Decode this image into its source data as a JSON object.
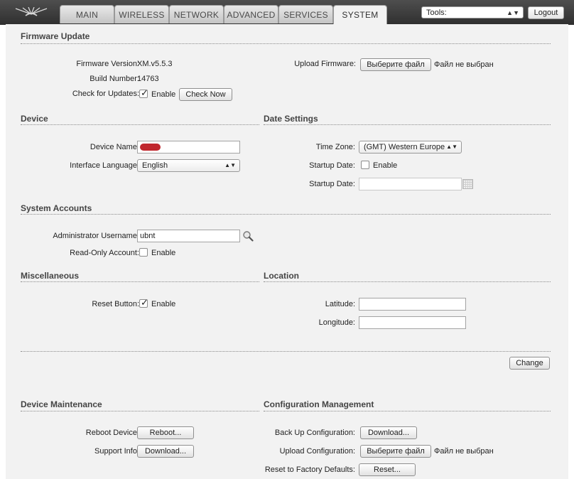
{
  "nav": {
    "tabs": [
      {
        "label": "MAIN"
      },
      {
        "label": "WIRELESS"
      },
      {
        "label": "NETWORK"
      },
      {
        "label": "ADVANCED"
      },
      {
        "label": "SERVICES"
      },
      {
        "label": "SYSTEM",
        "active": true
      }
    ],
    "tools_selected": "Tools:",
    "logout_label": "Logout"
  },
  "firmware": {
    "title": "Firmware Update",
    "version_label": "Firmware Version:",
    "version": "XM.v5.5.3",
    "build_label": "Build Number:",
    "build": "14763",
    "check_label": "Check for Updates:",
    "check_enabled": true,
    "enable_text": "Enable",
    "check_now": "Check Now",
    "upload_label": "Upload Firmware:",
    "choose_file": "Выберите файл",
    "no_file": "Файл не выбран"
  },
  "device": {
    "title": "Device",
    "name_label": "Device Name:",
    "lang_label": "Interface Language:",
    "lang_value": "English"
  },
  "date_settings": {
    "title": "Date Settings",
    "tz_label": "Time Zone:",
    "tz_value": "(GMT) Western Europe",
    "startup_label": "Startup Date:",
    "startup_enabled": false,
    "enable_text": "Enable",
    "startup_date_label": "Startup Date:"
  },
  "accounts": {
    "title": "System Accounts",
    "admin_label": "Administrator Username:",
    "admin_value": "ubnt",
    "readonly_label": "Read-Only Account:",
    "readonly_enabled": false,
    "enable_text": "Enable"
  },
  "misc": {
    "title": "Miscellaneous",
    "reset_label": "Reset Button:",
    "reset_enabled": true,
    "enable_text": "Enable"
  },
  "location": {
    "title": "Location",
    "lat_label": "Latitude:",
    "lon_label": "Longitude:"
  },
  "change_label": "Change",
  "maintenance": {
    "title": "Device Maintenance",
    "reboot_label": "Reboot Device:",
    "reboot_btn": "Reboot...",
    "support_label": "Support Info:",
    "support_btn": "Download..."
  },
  "config": {
    "title": "Configuration Management",
    "backup_label": "Back Up Configuration:",
    "backup_btn": "Download...",
    "upload_label": "Upload Configuration:",
    "choose_file": "Выберите файл",
    "no_file": "Файл не выбран",
    "reset_label": "Reset to Factory Defaults:",
    "reset_btn": "Reset..."
  }
}
